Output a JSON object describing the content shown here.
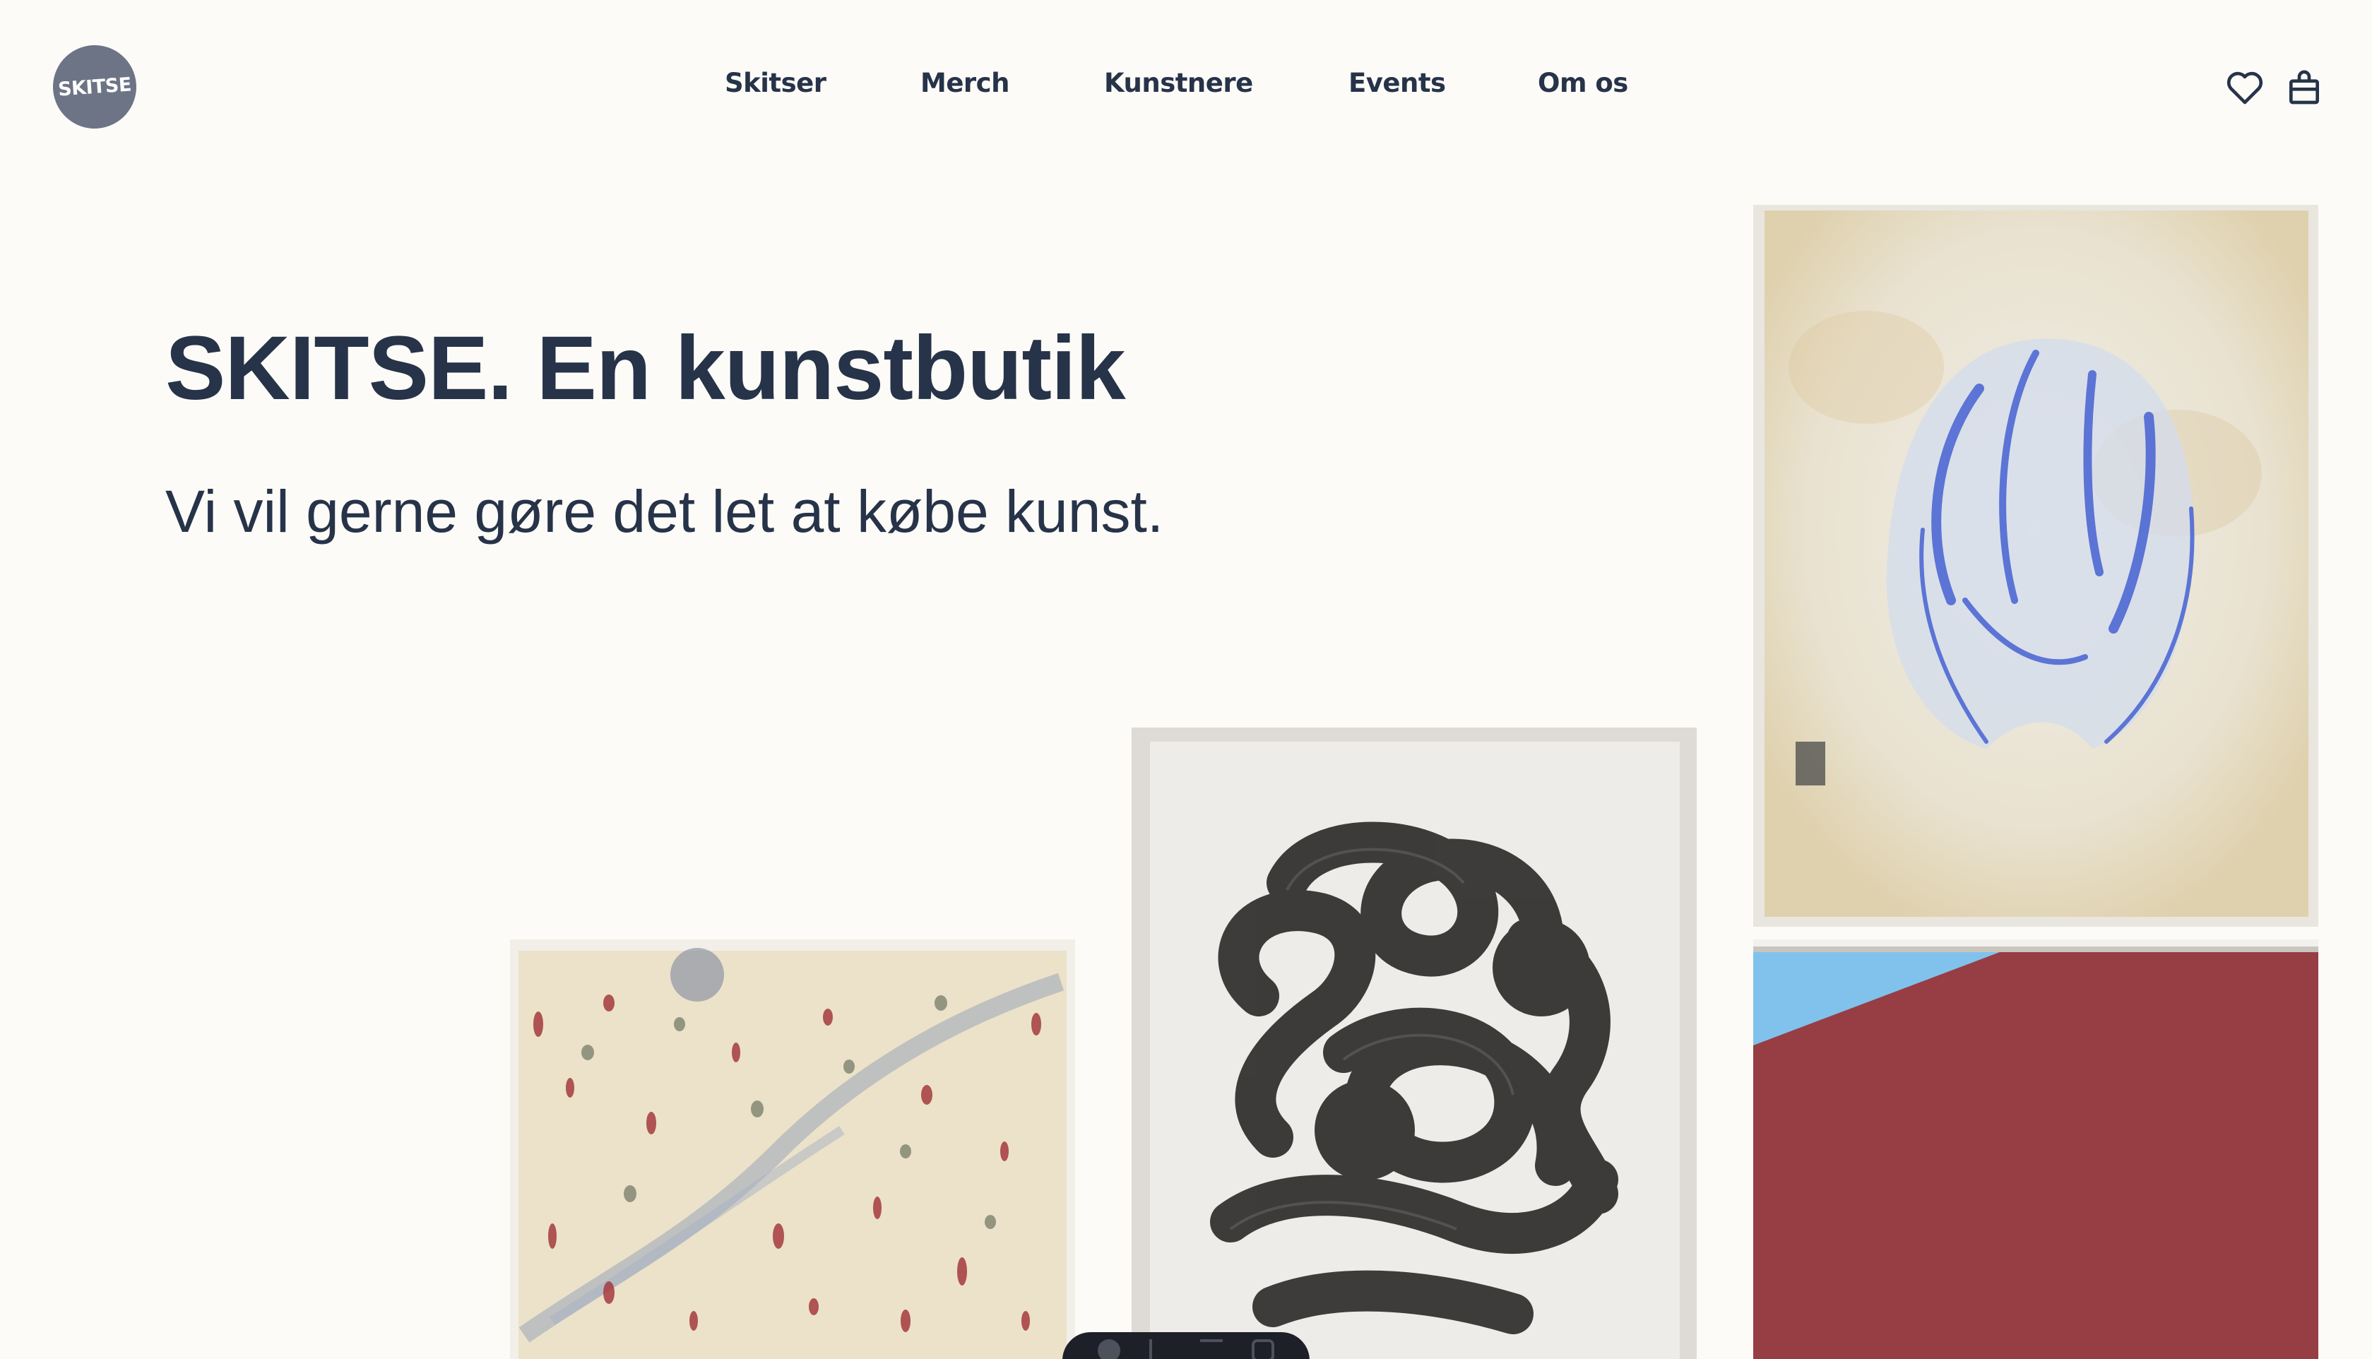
{
  "header": {
    "logo_text": "SKITSE",
    "nav": [
      "Skitser",
      "Merch",
      "Kunstnere",
      "Events",
      "Om os"
    ],
    "icons": [
      "heart-icon",
      "shopping-bag-icon"
    ]
  },
  "hero": {
    "title": "SKITSE. En kunstbutik",
    "subtitle": "Vi vil gerne gøre det let at købe kunst."
  },
  "colors": {
    "background": "#fdfbf7",
    "text": "#263349",
    "logo_bg": "#6c7486"
  }
}
